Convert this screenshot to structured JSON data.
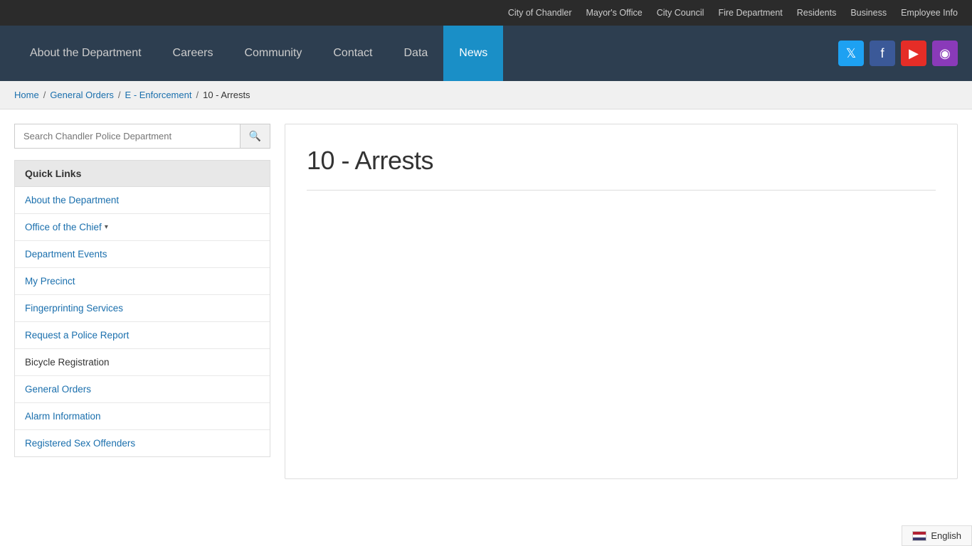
{
  "top_bar": {
    "links": [
      {
        "label": "City of Chandler",
        "id": "city-of-chandler"
      },
      {
        "label": "Mayor's Office",
        "id": "mayors-office"
      },
      {
        "label": "City Council",
        "id": "city-council"
      },
      {
        "label": "Fire Department",
        "id": "fire-department"
      },
      {
        "label": "Residents",
        "id": "residents"
      },
      {
        "label": "Business",
        "id": "business"
      },
      {
        "label": "Employee Info",
        "id": "employee-info"
      }
    ]
  },
  "nav": {
    "links": [
      {
        "label": "About the Department",
        "id": "about",
        "active": false
      },
      {
        "label": "Careers",
        "id": "careers",
        "active": false
      },
      {
        "label": "Community",
        "id": "community",
        "active": false
      },
      {
        "label": "Contact",
        "id": "contact",
        "active": false
      },
      {
        "label": "Data",
        "id": "data",
        "active": false
      },
      {
        "label": "News",
        "id": "news",
        "active": true
      }
    ],
    "social": [
      {
        "name": "twitter",
        "label": "Twitter"
      },
      {
        "name": "facebook",
        "label": "Facebook"
      },
      {
        "name": "youtube",
        "label": "YouTube"
      },
      {
        "name": "instagram",
        "label": "Instagram"
      }
    ]
  },
  "breadcrumb": {
    "items": [
      {
        "label": "Home",
        "link": true
      },
      {
        "label": "General Orders",
        "link": true
      },
      {
        "label": "E - Enforcement",
        "link": true
      },
      {
        "label": "10 - Arrests",
        "link": false
      }
    ]
  },
  "sidebar": {
    "search_placeholder": "Search Chandler Police Department",
    "search_button_label": "🔍",
    "quick_links_header": "Quick Links",
    "links": [
      {
        "label": "About the Department",
        "has_arrow": false,
        "color": "blue"
      },
      {
        "label": "Office of the Chief",
        "has_arrow": true,
        "color": "blue"
      },
      {
        "label": "Department Events",
        "has_arrow": false,
        "color": "blue"
      },
      {
        "label": "My Precinct",
        "has_arrow": false,
        "color": "blue"
      },
      {
        "label": "Fingerprinting Services",
        "has_arrow": false,
        "color": "blue"
      },
      {
        "label": "Request a Police Report",
        "has_arrow": false,
        "color": "blue"
      },
      {
        "label": "Bicycle Registration",
        "has_arrow": false,
        "color": "plain"
      },
      {
        "label": "General Orders",
        "has_arrow": false,
        "color": "blue"
      },
      {
        "label": "Alarm Information",
        "has_arrow": false,
        "color": "blue"
      },
      {
        "label": "Registered Sex Offenders",
        "has_arrow": false,
        "color": "blue"
      }
    ]
  },
  "main": {
    "title": "10 - Arrests"
  },
  "language": {
    "label": "English",
    "code": "en"
  }
}
